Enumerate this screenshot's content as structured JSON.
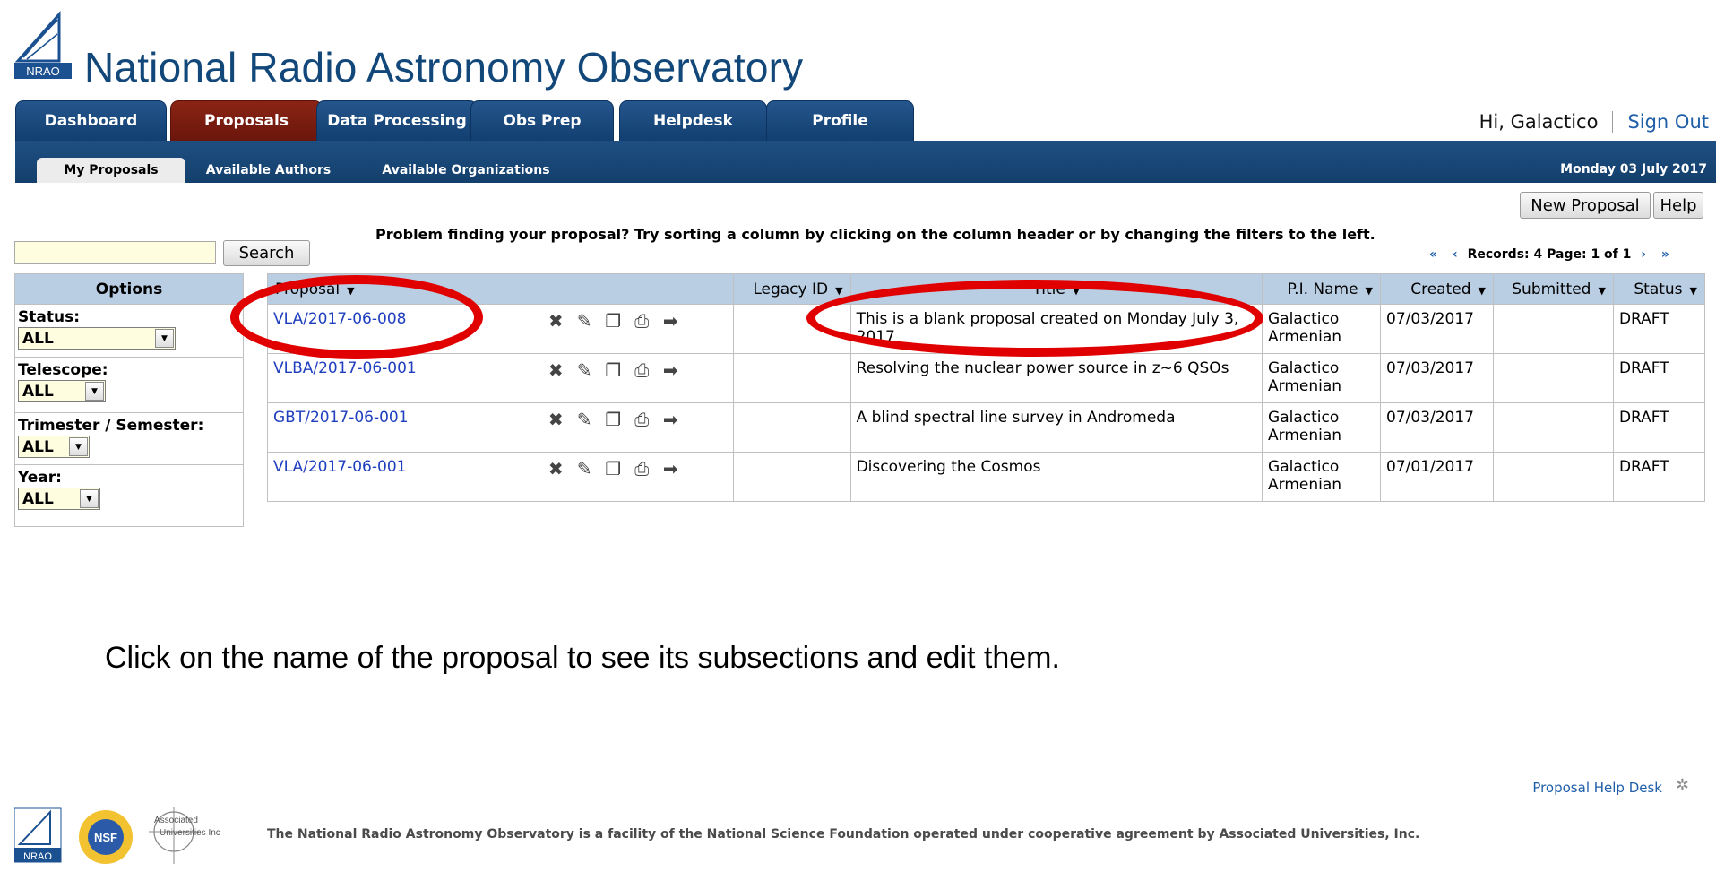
{
  "site": {
    "title": "National Radio Astronomy Observatory",
    "logo_text": "NRAO"
  },
  "main_tabs": [
    {
      "label": "Dashboard"
    },
    {
      "label": "Proposals"
    },
    {
      "label": "Data Processing"
    },
    {
      "label": "Obs Prep"
    },
    {
      "label": "Helpdesk"
    },
    {
      "label": "Profile"
    }
  ],
  "user": {
    "greeting": "Hi, Galactico",
    "sign_out": "Sign Out"
  },
  "sub_tabs": [
    {
      "label": "My Proposals"
    },
    {
      "label": "Available Authors"
    },
    {
      "label": "Available Organizations"
    }
  ],
  "date": "Monday 03 July 2017",
  "buttons": {
    "new_proposal": "New Proposal",
    "help": "Help",
    "search": "Search"
  },
  "search": {
    "value": ""
  },
  "hint": "Problem finding your proposal? Try sorting a column by clicking on the column header or by changing the filters to the left.",
  "pager": {
    "first": "«",
    "prev": "‹",
    "text": "Records: 4 Page: 1 of 1",
    "next": "›",
    "last": "»"
  },
  "options": {
    "heading": "Options",
    "filters": [
      {
        "label": "Status:",
        "value": "ALL"
      },
      {
        "label": "Telescope:",
        "value": "ALL"
      },
      {
        "label": "Trimester / Semester:",
        "value": "ALL"
      },
      {
        "label": "Year:",
        "value": "ALL"
      }
    ]
  },
  "table": {
    "headers": [
      "Proposal",
      "Legacy ID",
      "Title",
      "P.I. Name",
      "Created",
      "Submitted",
      "Status"
    ],
    "rows": [
      {
        "proposal": "VLA/2017-06-008",
        "legacy": "",
        "title": "This is a blank proposal created on Monday July 3, 2017",
        "pi": "Galactico Armenian",
        "created": "07/03/2017",
        "submitted": "",
        "status": "DRAFT"
      },
      {
        "proposal": "VLBA/2017-06-001",
        "legacy": "",
        "title": "Resolving the nuclear power source in z~6 QSOs",
        "pi": "Galactico Armenian",
        "created": "07/03/2017",
        "submitted": "",
        "status": "DRAFT"
      },
      {
        "proposal": "GBT/2017-06-001",
        "legacy": "",
        "title": "A blind spectral line survey in Andromeda",
        "pi": "Galactico Armenian",
        "created": "07/03/2017",
        "submitted": "",
        "status": "DRAFT"
      },
      {
        "proposal": "VLA/2017-06-001",
        "legacy": "",
        "title": "Discovering the Cosmos",
        "pi": "Galactico Armenian",
        "created": "07/01/2017",
        "submitted": "",
        "status": "DRAFT"
      }
    ]
  },
  "instruction": "Click on the name of the proposal to see its subsections and edit them.",
  "footer": {
    "help_desk": "Proposal Help Desk",
    "text": "The National Radio Astronomy Observatory is a facility of the National Science Foundation operated under cooperative agreement by Associated Universities, Inc.",
    "logo_nrao": "NRAO",
    "logo_nsf": "NSF",
    "logo_aui": "Associated Universities Inc"
  },
  "colors": {
    "nav_blue": "#1f4f82",
    "active_tab": "#8a2416",
    "annotation": "#e10000",
    "link": "#1f3fbf"
  }
}
